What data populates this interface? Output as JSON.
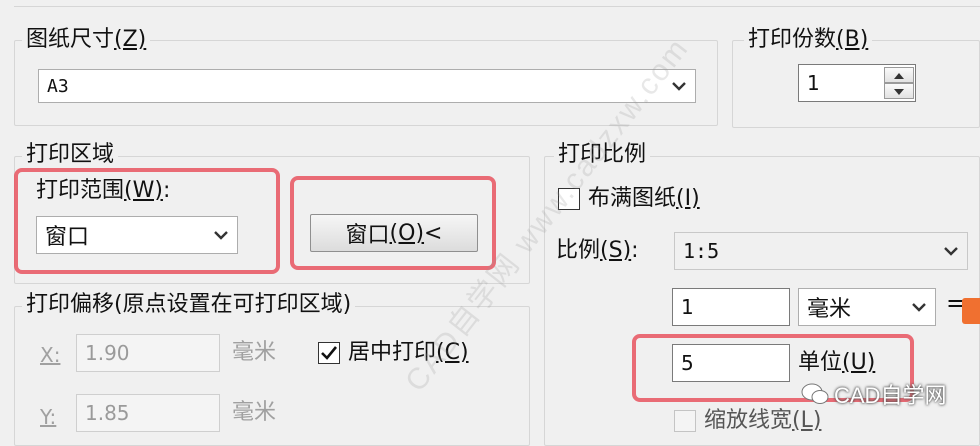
{
  "paper_size": {
    "label": "图纸尺寸(Z)",
    "label_pre": "图纸尺寸",
    "label_key": "(Z)",
    "value": "A3"
  },
  "copies": {
    "label": "打印份数(B)",
    "label_pre": "打印份数",
    "label_key": "(B)",
    "value": "1"
  },
  "plot_area": {
    "title": "打印区域",
    "what_label": "打印范围(W):",
    "what_label_pre": "打印范围",
    "what_label_key": "(W)",
    "what_label_post": ":",
    "what_value": "窗口",
    "window_button": "窗口(O)<",
    "window_button_pre": "窗口",
    "window_button_key": "(O)",
    "window_button_post": "<"
  },
  "plot_scale": {
    "title": "打印比例",
    "fit_paper": {
      "label": "布满图纸(I)",
      "label_pre": "布满图纸",
      "label_key": "(I)",
      "checked": false
    },
    "scale_label": "比例(S):",
    "scale_label_pre": "比例",
    "scale_label_key": "(S)",
    "scale_label_post": ":",
    "scale_value": "1:5",
    "numerator": "1",
    "unit_value": "毫米",
    "equals": "=",
    "denominator": "5",
    "units_label": "单位(U)",
    "units_label_pre": "单位",
    "units_label_key": "(U)",
    "scale_lineweights": {
      "label": "缩放线宽(L)",
      "label_pre": "缩放线宽",
      "label_key": "(L)",
      "checked": false
    }
  },
  "plot_offset": {
    "title": "打印偏移(原点设置在可打印区域)",
    "x_label": "X:",
    "x_value": "1.90",
    "x_unit": "毫米",
    "y_label": "Y:",
    "y_value": "1.85",
    "y_unit": "毫米",
    "center": {
      "label": "居中打印(C)",
      "label_pre": "居中打印",
      "label_key": "(C)",
      "checked": true
    }
  },
  "watermarks": {
    "diagonal": "CAD自学网 www.cadzxw.com",
    "footer": "CAD自学网"
  },
  "colors": {
    "highlight": "#e8535f",
    "background": "#f0f0f0"
  }
}
